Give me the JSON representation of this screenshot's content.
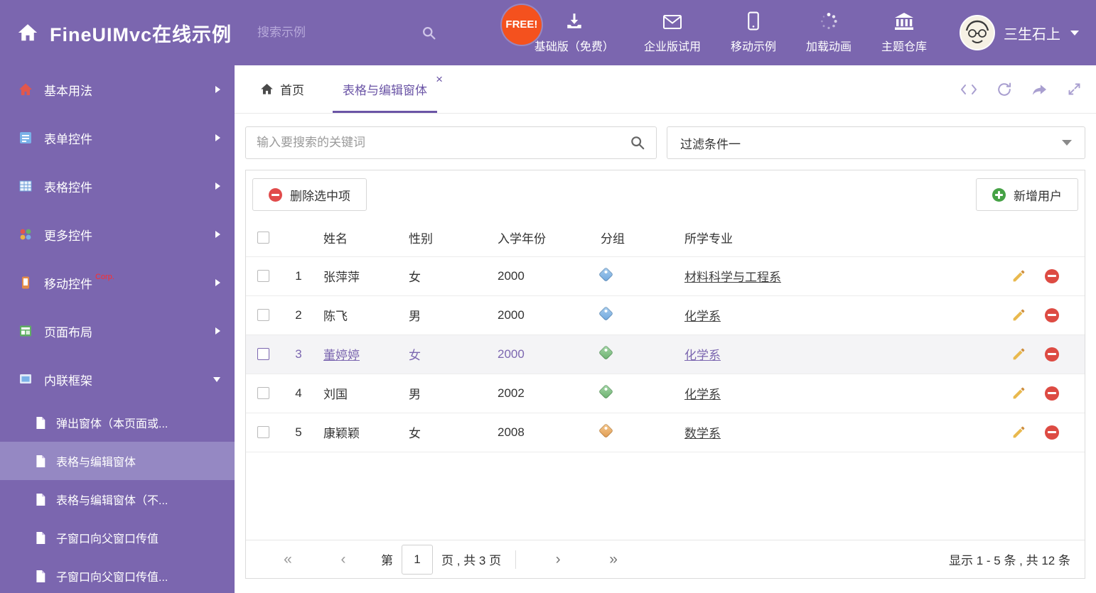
{
  "header": {
    "logo": "FineUIMvc在线示例",
    "search_placeholder": "搜索示例",
    "free_badge": "FREE!",
    "nav": [
      {
        "label": "基础版（免费）"
      },
      {
        "label": "企业版试用"
      },
      {
        "label": "移动示例"
      },
      {
        "label": "加载动画"
      },
      {
        "label": "主题仓库"
      }
    ],
    "user": "三生石上"
  },
  "sidebar": {
    "items": [
      {
        "label": "基本用法"
      },
      {
        "label": "表单控件"
      },
      {
        "label": "表格控件"
      },
      {
        "label": "更多控件"
      },
      {
        "label": "移动控件",
        "badge": "Corp."
      },
      {
        "label": "页面布局"
      },
      {
        "label": "内联框架"
      }
    ],
    "subitems": [
      {
        "label": "弹出窗体（本页面或..."
      },
      {
        "label": "表格与编辑窗体"
      },
      {
        "label": "表格与编辑窗体（不..."
      },
      {
        "label": "子窗口向父窗口传值"
      },
      {
        "label": "子窗口向父窗口传值..."
      }
    ]
  },
  "tabs": {
    "home": "首页",
    "active": "表格与编辑窗体"
  },
  "icons": {
    "close": "×",
    "page_first": "«",
    "page_prev": "‹",
    "page_next": "›",
    "page_last": "»"
  },
  "filter": {
    "search_placeholder": "输入要搜索的关键词",
    "dropdown_value": "过滤条件一"
  },
  "toolbar": {
    "delete_selected": "删除选中项",
    "add_user": "新增用户"
  },
  "table": {
    "columns": [
      "姓名",
      "性别",
      "入学年份",
      "分组",
      "所学专业"
    ],
    "rows": [
      {
        "num": "1",
        "name": "张萍萍",
        "gender": "女",
        "year": "2000",
        "tag": "blue",
        "major": "材料科学与工程系"
      },
      {
        "num": "2",
        "name": "陈飞",
        "gender": "男",
        "year": "2000",
        "tag": "blue",
        "major": "化学系"
      },
      {
        "num": "3",
        "name": "董婷婷",
        "gender": "女",
        "year": "2000",
        "tag": "green",
        "major": "化学系"
      },
      {
        "num": "4",
        "name": "刘国",
        "gender": "男",
        "year": "2002",
        "tag": "green",
        "major": "化学系"
      },
      {
        "num": "5",
        "name": "康颖颖",
        "gender": "女",
        "year": "2008",
        "tag": "orange",
        "major": "数学系"
      }
    ]
  },
  "pagination": {
    "page_prefix": "第",
    "page_value": "1",
    "page_suffix": "页 , 共 3 页",
    "summary": "显示 1 - 5 条 , 共 12 条"
  },
  "colors": {
    "theme_purple": "#7b66af",
    "active_item": "#9588c3",
    "free_badge": "#f4511e",
    "delete_red": "#e14b4b",
    "add_green": "#46a246",
    "tag_blue": "#6ea6dd",
    "tag_green": "#69b06d",
    "tag_orange": "#e09a4f",
    "edit_pencil": "#e9b94e"
  }
}
